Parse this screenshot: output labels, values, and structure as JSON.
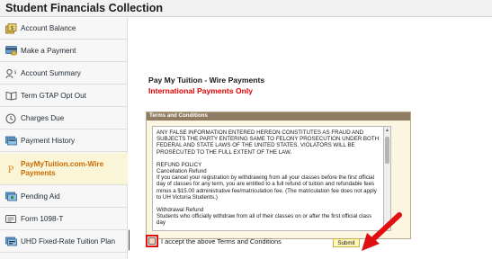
{
  "header": {
    "title": "Student Financials Collection"
  },
  "sidebar": {
    "items": [
      {
        "label": "Account Balance",
        "icon": "account-balance-icon",
        "active": false
      },
      {
        "label": "Make a Payment",
        "icon": "payment-card-icon",
        "active": false
      },
      {
        "label": "Account Summary",
        "icon": "account-summary-icon",
        "active": false
      },
      {
        "label": "Term GTAP Opt Out",
        "icon": "book-icon",
        "active": false
      },
      {
        "label": "Charges Due",
        "icon": "clock-icon",
        "active": false
      },
      {
        "label": "Payment History",
        "icon": "payment-history-icon",
        "active": false
      },
      {
        "label": "PayMyTuition.com-Wire Payments",
        "icon": "paymytuition-icon",
        "active": true
      },
      {
        "label": "Pending Aid",
        "icon": "pending-aid-icon",
        "active": false
      },
      {
        "label": "Form 1098-T",
        "icon": "form-icon",
        "active": false
      },
      {
        "label": "UHD Fixed-Rate Tuition Plan",
        "icon": "tuition-plan-icon",
        "active": false
      }
    ]
  },
  "main": {
    "title": "Pay My Tuition - Wire Payments",
    "notice": "International Payments Only",
    "terms": {
      "header": "Terms and Conditions",
      "paragraphs": [
        "ANY FALSE INFORMATION ENTERED HEREON CONSTITUTES AS FRAUD AND SUBJECTS THE PARTY ENTERING SAME TO FELONY PROSECUTION UNDER BOTH FEDERAL AND STATE LAWS OF THE UNITED STATES.  VIOLATORS WILL BE PROSECUTED TO THE FULL EXTENT OF THE LAW.",
        "REFUND POLICY",
        "Cancellation Refund",
        "If you cancel your registration by withdrawing from all your classes before the first official day of classes for any term, you are entitled to a full refund of tuition and refundable fees minus a $15.00 administrative fee/matriculation fee.  (The matriculation fee does not apply to UH Victoria Students.)",
        "Withdrawal Refund",
        "Students who officially withdraw from all of their classes on or after the first official class day"
      ]
    },
    "accept_label": "I accept the above Terms and Conditions",
    "accept_checked": false,
    "submit_label": "Submit"
  },
  "colors": {
    "active_label": "#cc6a00",
    "notice": "#e00000",
    "terms_header_bg": "#8f7c63",
    "annotation": "#e01010"
  },
  "collapse_handle": {
    "label": "||"
  }
}
